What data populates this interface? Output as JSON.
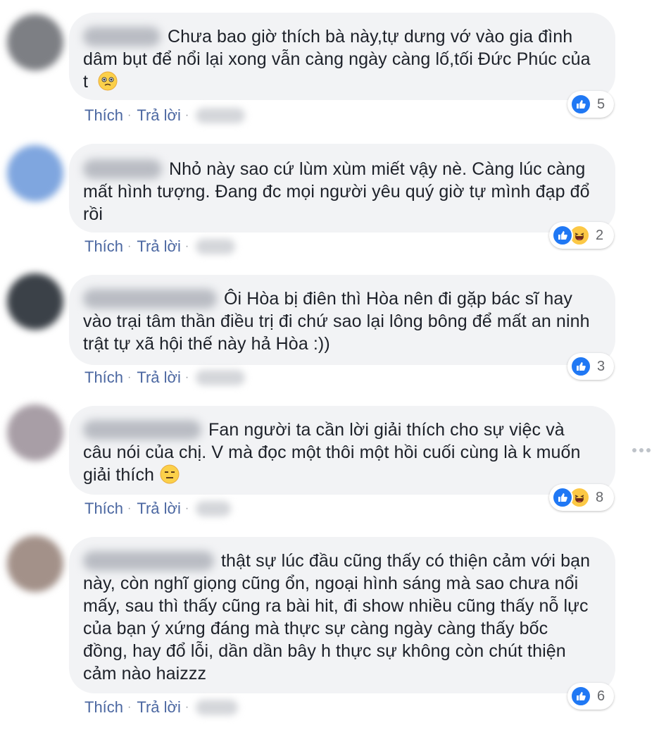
{
  "actions": {
    "like_label": "Thích",
    "reply_label": "Trả lời",
    "separator": "·"
  },
  "comments": [
    {
      "text": "Chưa bao giờ thích bà này,tự dưng vớ vào gia đình dâm bụt để nổi lại xong vẫn càng ngày càng lố,tối Đức Phúc của t",
      "emoji": "pleading-face-emoji",
      "reactions": [
        "like-icon"
      ],
      "reaction_count": "5"
    },
    {
      "text": "Nhỏ này sao cứ lùm xùm miết vậy nè. Càng lúc càng mất hình tượng. Đang đc mọi người yêu quý giờ tự mình đạp đổ rồi",
      "reactions": [
        "like-icon",
        "haha-icon"
      ],
      "reaction_count": "2"
    },
    {
      "text": "Ôi Hòa bị điên thì Hòa nên đi gặp bác sĩ hay vào trại tâm thần điều trị đi chứ sao lại lông bông để mất an ninh trật tự xã hội thế này hả Hòa :))",
      "reactions": [
        "like-icon"
      ],
      "reaction_count": "3"
    },
    {
      "text": "Fan người ta cần lời giải thích cho sự việc và câu nói của chị. V mà đọc một thôi một hồi cuối cùng là k muốn giải thích",
      "emoji": "expressionless-face-emoji",
      "reactions": [
        "like-icon",
        "haha-icon"
      ],
      "reaction_count": "8"
    },
    {
      "text": "thật sự lúc đầu cũng thấy có thiện cảm với bạn này, còn nghĩ giọng cũng ổn, ngoại hình sáng mà sao chưa nổi mấy, sau thì thấy cũng ra bài hit, đi show nhiều cũng thấy nỗ lực của bạn ý xứng đáng mà thực sự càng ngày càng thấy bốc đồng, hay đổ lỗi, dần dần bây h thực sự không còn chút thiện cảm nào haizzz",
      "reactions": [
        "like-icon"
      ],
      "reaction_count": "6"
    }
  ],
  "colors": {
    "bubble": "#f2f3f5",
    "link": "#4b67a1",
    "like": "#2078f4",
    "haha": "#fcc845"
  }
}
